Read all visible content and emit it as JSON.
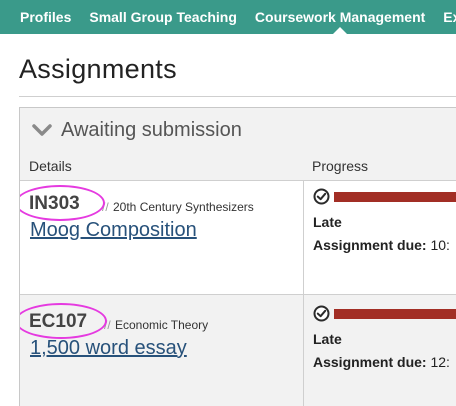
{
  "nav": {
    "items": [
      {
        "label": "Profiles",
        "active": false
      },
      {
        "label": "Small Group Teaching",
        "active": false
      },
      {
        "label": "Coursework Management",
        "active": true
      },
      {
        "label": "Exam",
        "active": false
      }
    ]
  },
  "page": {
    "title": "Assignments"
  },
  "panel": {
    "title": "Awaiting submission",
    "columns": {
      "details": "Details",
      "progress": "Progress"
    }
  },
  "assignments": [
    {
      "code": "IN303",
      "separator": "//",
      "module": "20th Century Synthesizers",
      "title": "Moog Composition",
      "status": "Late",
      "due_label": "Assignment due:",
      "due_value": "10:",
      "progress_color": "#a22e25"
    },
    {
      "code": "EC107",
      "separator": "//",
      "module": "Economic Theory",
      "title": "1,500 word essay",
      "status": "Late",
      "due_label": "Assignment due:",
      "due_value": "12:",
      "progress_color": "#a22e25"
    }
  ],
  "colors": {
    "nav_bg": "#3a9a8a",
    "late_bar": "#a22e25",
    "link": "#27517a",
    "highlight_ring": "#e53ae0"
  }
}
